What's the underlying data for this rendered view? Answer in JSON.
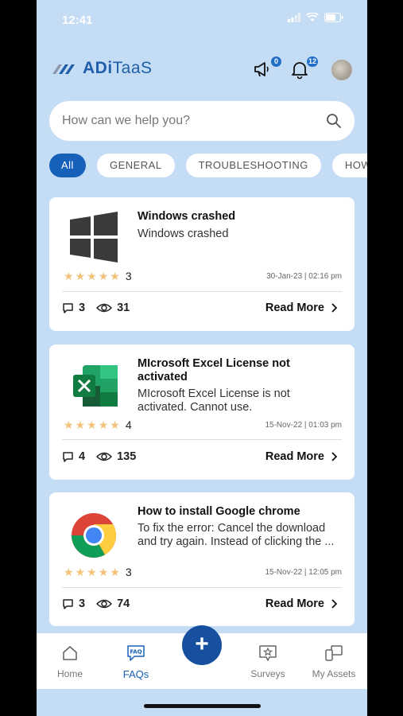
{
  "status_bar": {
    "time": "12:41"
  },
  "header": {
    "logo_text_bold": "ADi",
    "logo_text_regular": "TaaS",
    "announcements_badge": "0",
    "notifications_badge": "12"
  },
  "search": {
    "placeholder": "How can we help you?"
  },
  "filters": [
    "All",
    "GENERAL",
    "TROUBLESHOOTING",
    "HOW"
  ],
  "cards": [
    {
      "icon": "windows-logo",
      "title": "Windows crashed",
      "description": "Windows crashed",
      "rating": "3",
      "stars": 5,
      "date": "30-Jan-23 | 02:16 pm",
      "comments": "3",
      "views": "31",
      "read_more": "Read More"
    },
    {
      "icon": "excel-logo",
      "title": "MIcrosoft Excel License not activated",
      "description": "MIcrosoft Excel License is not activated. Cannot use.",
      "rating": "4",
      "stars": 5,
      "date": "15-Nov-22 | 01:03 pm",
      "comments": "4",
      "views": "135",
      "read_more": "Read More"
    },
    {
      "icon": "chrome-logo",
      "title": "How to install Google chrome",
      "description": "To fix the error: Cancel the download and try again. Instead of clicking the ...",
      "rating": "3",
      "stars": 5,
      "date": "15-Nov-22 | 12:05 pm",
      "comments": "3",
      "views": "74",
      "read_more": "Read More"
    }
  ],
  "bottom_nav": {
    "home": "Home",
    "faqs": "FAQs",
    "surveys": "Surveys",
    "assets": "My Assets",
    "active": "FAQs"
  },
  "colors": {
    "background": "#c5dcf5",
    "accent": "#1760b9",
    "star": "#f2c27a"
  }
}
